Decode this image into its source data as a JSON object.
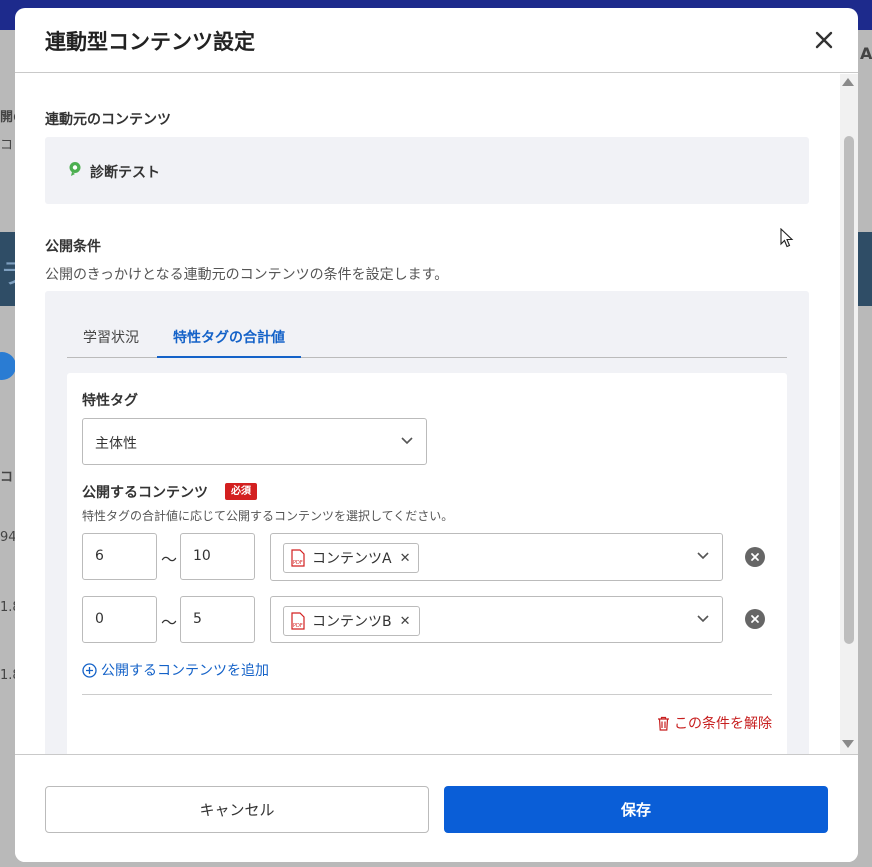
{
  "colors": {
    "primary": "#0a5ed7",
    "link": "#1462c8",
    "danger": "#d32020",
    "panel": "#f1f2f6"
  },
  "background": {
    "fragments": [
      "開の",
      "コ",
      "ラ",
      "コ",
      "94",
      "1.8",
      "1.8",
      "A"
    ]
  },
  "modal": {
    "title": "連動型コンテンツ設定",
    "close_icon": "close-icon",
    "source_section": {
      "label": "連動元のコンテンツ",
      "content_name": "診断テスト",
      "icon": "diagnosis-icon"
    },
    "condition_section": {
      "label": "公開条件",
      "description": "公開のきっかけとなる連動元のコンテンツの条件を設定します。",
      "tabs": [
        {
          "label": "学習状況",
          "active": false
        },
        {
          "label": "特性タグの合計値",
          "active": true
        }
      ],
      "tag_field": {
        "label": "特性タグ",
        "value": "主体性"
      },
      "content_field": {
        "label": "公開するコンテンツ",
        "required_badge": "必須",
        "help": "特性タグの合計値に応じて公開するコンテンツを選択してください。",
        "range_separator": "〜",
        "rows": [
          {
            "min": "6",
            "max": "10",
            "content": "コンテンツA",
            "icon": "pdf-icon"
          },
          {
            "min": "0",
            "max": "5",
            "content": "コンテンツB",
            "icon": "pdf-icon"
          }
        ],
        "add_link": "公開するコンテンツを追加"
      },
      "delete_condition": "この条件を解除"
    },
    "footer": {
      "cancel": "キャンセル",
      "save": "保存"
    }
  }
}
